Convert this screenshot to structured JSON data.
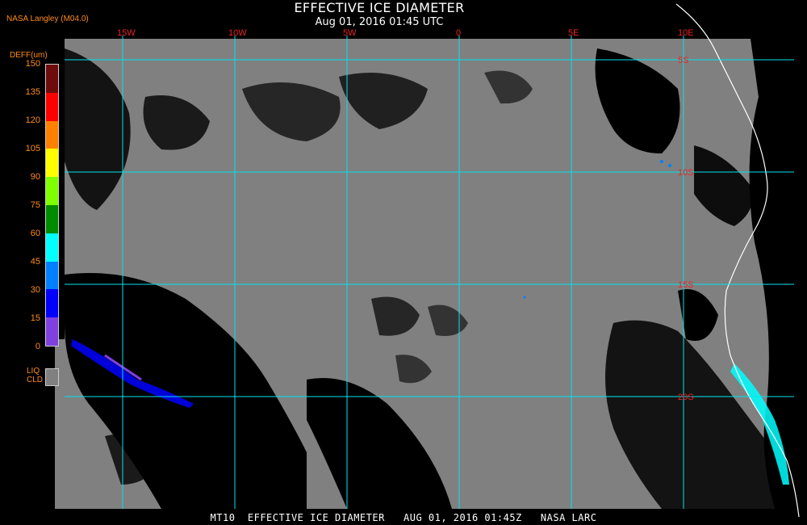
{
  "header": {
    "title": "EFFECTIVE ICE DIAMETER",
    "subtitle": "Aug 01, 2016 01:45 UTC",
    "credit": "NASA Langley (M04.0)"
  },
  "legend": {
    "unit": "DEFF(um)",
    "ticks": [
      "150",
      "135",
      "120",
      "105",
      "90",
      "75",
      "60",
      "45",
      "30",
      "15",
      "0"
    ],
    "colors": [
      "#6e0b0b",
      "#ff0000",
      "#ff8000",
      "#ffff00",
      "#80ff00",
      "#008c00",
      "#00ffff",
      "#0080ff",
      "#0000ff",
      "#8040e0"
    ],
    "liquid_label_line1": "LIQ",
    "liquid_label_line2": "CLD",
    "liquid_color": "#808080"
  },
  "map": {
    "land_color": "#000000",
    "cloud_color": "#808080",
    "grid_color": "#00e5ee",
    "label_color": "#ee2222",
    "lon_labels": [
      "15W",
      "10W",
      "5W",
      "0",
      "5E",
      "10E"
    ],
    "lat_labels": [
      "5S",
      "10S",
      "15S",
      "20S"
    ]
  },
  "footer": {
    "text": "MT10  EFFECTIVE ICE DIAMETER   AUG 01, 2016 01:45Z   NASA LARC"
  }
}
